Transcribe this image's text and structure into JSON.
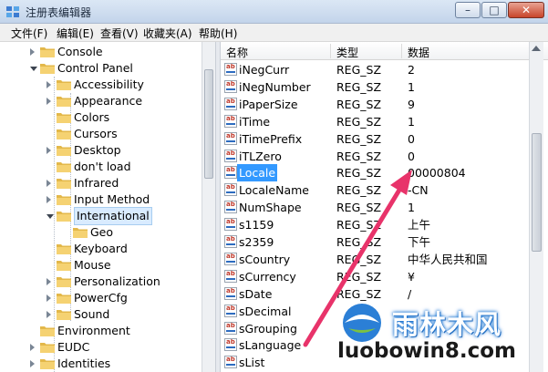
{
  "window": {
    "title": "注册表编辑器",
    "minimize": "–",
    "maximize": "□",
    "close": "✕"
  },
  "menu": [
    "文件(F)",
    "编辑(E)",
    "查看(V)",
    "收藏夹(A)",
    "帮助(H)"
  ],
  "tree": [
    {
      "label": "Console",
      "level": 1,
      "expand": "closed"
    },
    {
      "label": "Control Panel",
      "level": 1,
      "expand": "open"
    },
    {
      "label": "Accessibility",
      "level": 2,
      "expand": "closed"
    },
    {
      "label": "Appearance",
      "level": 2,
      "expand": "closed"
    },
    {
      "label": "Colors",
      "level": 2,
      "expand": "none"
    },
    {
      "label": "Cursors",
      "level": 2,
      "expand": "none"
    },
    {
      "label": "Desktop",
      "level": 2,
      "expand": "closed"
    },
    {
      "label": "don't load",
      "level": 2,
      "expand": "none"
    },
    {
      "label": "Infrared",
      "level": 2,
      "expand": "closed"
    },
    {
      "label": "Input Method",
      "level": 2,
      "expand": "closed"
    },
    {
      "label": "International",
      "level": 2,
      "expand": "open",
      "selected": true
    },
    {
      "label": "Geo",
      "level": 3,
      "expand": "none"
    },
    {
      "label": "Keyboard",
      "level": 2,
      "expand": "none"
    },
    {
      "label": "Mouse",
      "level": 2,
      "expand": "none"
    },
    {
      "label": "Personalization",
      "level": 2,
      "expand": "closed"
    },
    {
      "label": "PowerCfg",
      "level": 2,
      "expand": "closed"
    },
    {
      "label": "Sound",
      "level": 2,
      "expand": "closed"
    },
    {
      "label": "Environment",
      "level": 1,
      "expand": "none"
    },
    {
      "label": "EUDC",
      "level": 1,
      "expand": "closed"
    },
    {
      "label": "Identities",
      "level": 1,
      "expand": "closed"
    }
  ],
  "list": {
    "headers": {
      "name": "名称",
      "type": "类型",
      "data": "数据"
    },
    "rows": [
      {
        "name": "iNegCurr",
        "type": "REG_SZ",
        "data": "2"
      },
      {
        "name": "iNegNumber",
        "type": "REG_SZ",
        "data": "1"
      },
      {
        "name": "iPaperSize",
        "type": "REG_SZ",
        "data": "9"
      },
      {
        "name": "iTime",
        "type": "REG_SZ",
        "data": "1"
      },
      {
        "name": "iTimePrefix",
        "type": "REG_SZ",
        "data": "0"
      },
      {
        "name": "iTLZero",
        "type": "REG_SZ",
        "data": "0"
      },
      {
        "name": "Locale",
        "type": "REG_SZ",
        "data": "00000804",
        "selected": true
      },
      {
        "name": "LocaleName",
        "type": "REG_SZ",
        "data": "-CN"
      },
      {
        "name": "NumShape",
        "type": "REG_SZ",
        "data": "1"
      },
      {
        "name": "s1159",
        "type": "REG_SZ",
        "data": "上午"
      },
      {
        "name": "s2359",
        "type": "REG_SZ",
        "data": "下午"
      },
      {
        "name": "sCountry",
        "type": "REG_SZ",
        "data": "中华人民共和国"
      },
      {
        "name": "sCurrency",
        "type": "REG_SZ",
        "data": "¥"
      },
      {
        "name": "sDate",
        "type": "REG_SZ",
        "data": "/"
      },
      {
        "name": "sDecimal",
        "type": "",
        "data": ""
      },
      {
        "name": "sGrouping",
        "type": "",
        "data": ""
      },
      {
        "name": "sLanguage",
        "type": "",
        "data": ""
      },
      {
        "name": "sList",
        "type": "",
        "data": ""
      }
    ]
  },
  "icons": {
    "value_icon": "ab-string-value-icon",
    "folder_icon": "folder-icon"
  },
  "colors": {
    "selection": "#3399ff",
    "annotation_arrow": "#e8336a",
    "watermark_blue": "#2b7fd6"
  },
  "watermark": {
    "site_cn": "雨林木风",
    "url": "luobowin8.com"
  }
}
